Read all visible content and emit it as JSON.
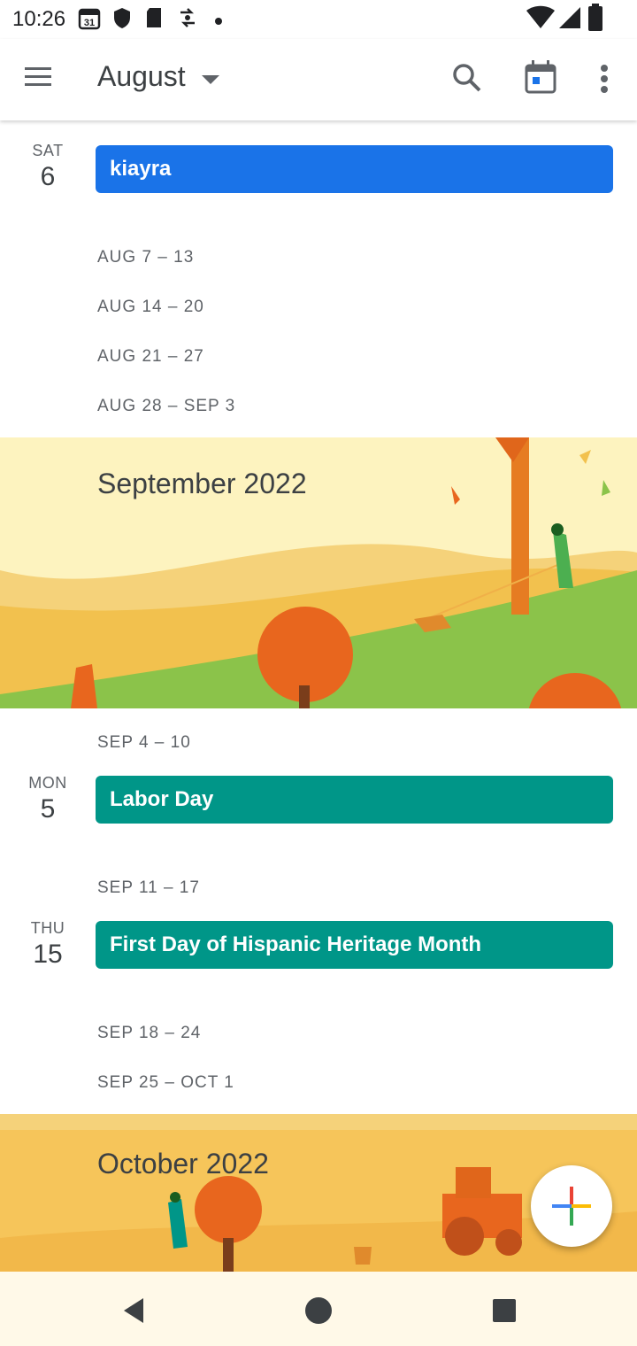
{
  "status_bar": {
    "time": "10:26",
    "calendar_badge": "31"
  },
  "app_bar": {
    "month_title": "August"
  },
  "agenda": {
    "day_sat6": {
      "dow": "SAT",
      "day": "6",
      "event": "kiayra",
      "color": "#1a73e8"
    },
    "weeks_aug": [
      "AUG 7 – 13",
      "AUG 14 – 20",
      "AUG 21 – 27",
      "AUG 28 – SEP 3"
    ],
    "september_banner": "September 2022",
    "week_sep4": "SEP 4 – 10",
    "day_mon5": {
      "dow": "MON",
      "day": "5",
      "event": "Labor Day",
      "color": "#009688"
    },
    "week_sep11": "SEP 11 – 17",
    "day_thu15": {
      "dow": "THU",
      "day": "15",
      "event": "First Day of Hispanic Heritage Month",
      "color": "#009688"
    },
    "week_sep18": "SEP 18 – 24",
    "week_sep25": "SEP 25 – OCT 1",
    "october_banner": "October 2022"
  },
  "icons": {
    "menu": "menu-icon",
    "caret": "dropdown-caret-icon",
    "search": "search-icon",
    "today": "today-calendar-icon",
    "more": "more-vert-icon",
    "fab": "plus-icon"
  }
}
